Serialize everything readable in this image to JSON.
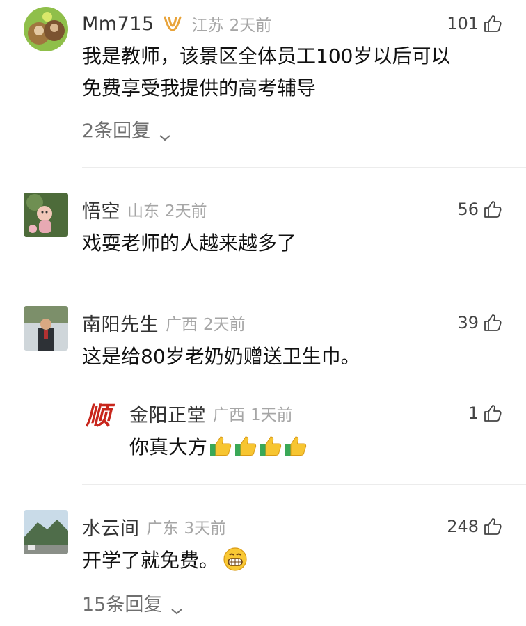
{
  "comments": [
    {
      "username": "Mm715",
      "location": "江苏",
      "time": "2天前",
      "likes": "101",
      "text_lines": [
        "我是教师，该景区全体员工100岁以后可以",
        "免费享受我提供的高考辅导"
      ],
      "replies_label": "2条回复"
    },
    {
      "username": "悟空",
      "location": "山东",
      "time": "2天前",
      "likes": "56",
      "text": "戏耍老师的人越来越多了"
    },
    {
      "username": "南阳先生",
      "location": "广西",
      "time": "2天前",
      "likes": "39",
      "text": "这是给80岁老奶奶赠送卫生巾。",
      "reply": {
        "avatar_glyph": "顺",
        "username": "金阳正堂",
        "location": "广西",
        "time": "1天前",
        "likes": "1",
        "text": "你真大方"
      }
    },
    {
      "username": "水云间",
      "location": "广东",
      "time": "3天前",
      "likes": "248",
      "text": "开学了就免费。",
      "replies_label": "15条回复"
    }
  ],
  "colors": {
    "meta_gray": "#a6a6a6",
    "vip_orange": "#e8a33a",
    "logo_red": "#c8261c"
  },
  "icons": [
    "thumbs-up-outline-icon",
    "vip-badge-icon",
    "chevron-down-icon",
    "thumbs-up-emoji-icon",
    "grinning-emoji-icon"
  ]
}
